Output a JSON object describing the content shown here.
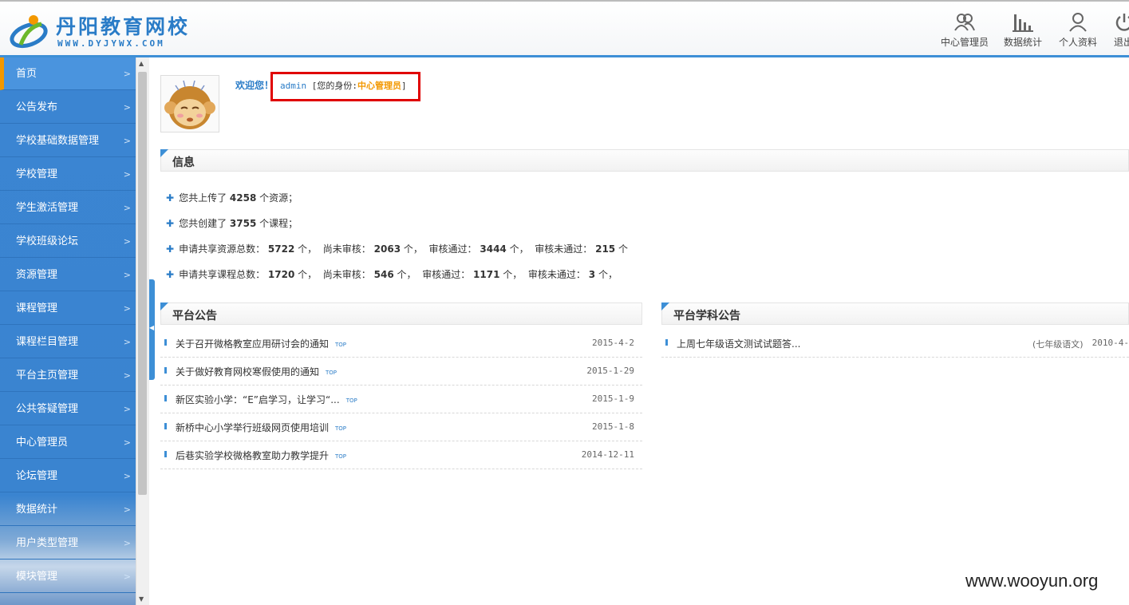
{
  "brand": {
    "title": "丹阳教育网校",
    "subtitle": "WWW.DYJYWX.COM"
  },
  "topnav": [
    {
      "label": "中心管理员",
      "icon": "users-icon"
    },
    {
      "label": "数据统计",
      "icon": "bar-chart-icon"
    },
    {
      "label": "个人资料",
      "icon": "user-icon"
    },
    {
      "label": "退出",
      "icon": "power-icon"
    }
  ],
  "sidebar": {
    "items": [
      {
        "label": "首页",
        "active": true
      },
      {
        "label": "公告发布"
      },
      {
        "label": "学校基础数据管理"
      },
      {
        "label": "学校管理"
      },
      {
        "label": "学生激活管理"
      },
      {
        "label": "学校班级论坛"
      },
      {
        "label": "资源管理"
      },
      {
        "label": "课程管理"
      },
      {
        "label": "课程栏目管理"
      },
      {
        "label": "平台主页管理"
      },
      {
        "label": "公共答疑管理"
      },
      {
        "label": "中心管理员"
      },
      {
        "label": "论坛管理"
      },
      {
        "label": "数据统计"
      },
      {
        "label": "用户类型管理"
      },
      {
        "label": "模块管理"
      }
    ],
    "accent": "#3b85d2",
    "active_marker": "#f39800"
  },
  "welcome": {
    "greeting": "欢迎您！",
    "username": "admin",
    "role_prefix": "[您的身份:",
    "role": "中心管理员",
    "role_suffix": "]"
  },
  "info": {
    "title": "信息",
    "uploaded": {
      "pre": "您共上传了",
      "count": "4258",
      "post": "个资源；"
    },
    "created": {
      "pre": "您共创建了",
      "count": "3755",
      "post": "个课程；"
    },
    "resources": {
      "label": "申请共享资源总数：",
      "total": "5722",
      "unit1": "个，",
      "pending_label": "尚未审核：",
      "pending": "2063",
      "unit2": "个，",
      "approved_label": "审核通过：",
      "approved": "3444",
      "unit3": "个，",
      "rejected_label": "审核未通过：",
      "rejected": "215",
      "unit4": "个"
    },
    "courses": {
      "label": "申请共享课程总数：",
      "total": "1720",
      "unit1": "个，",
      "pending_label": "尚未审核：",
      "pending": "546",
      "unit2": "个，",
      "approved_label": "审核通过：",
      "approved": "1171",
      "unit3": "个，",
      "rejected_label": "审核未通过：",
      "rejected": "3",
      "unit4": "个，"
    }
  },
  "platform_notices": {
    "title": "平台公告",
    "top_badge": "TOP",
    "items": [
      {
        "title": "关于召开微格教室应用研讨会的通知",
        "date": "2015-4-2"
      },
      {
        "title": "关于做好教育网校寒假使用的通知",
        "date": "2015-1-29"
      },
      {
        "title": "新区实验小学：“E”启学习，让学习“...",
        "date": "2015-1-9"
      },
      {
        "title": "新桥中心小学举行班级网页使用培训",
        "date": "2015-1-8"
      },
      {
        "title": "后巷实验学校微格教室助力教学提升",
        "date": "2014-12-11"
      }
    ]
  },
  "subject_notices": {
    "title": "平台学科公告",
    "items": [
      {
        "title": "上周七年级语文测试试题答...",
        "category": "(七年级语文)",
        "date": "2010-4-"
      }
    ]
  },
  "watermark": "www.wooyun.org"
}
